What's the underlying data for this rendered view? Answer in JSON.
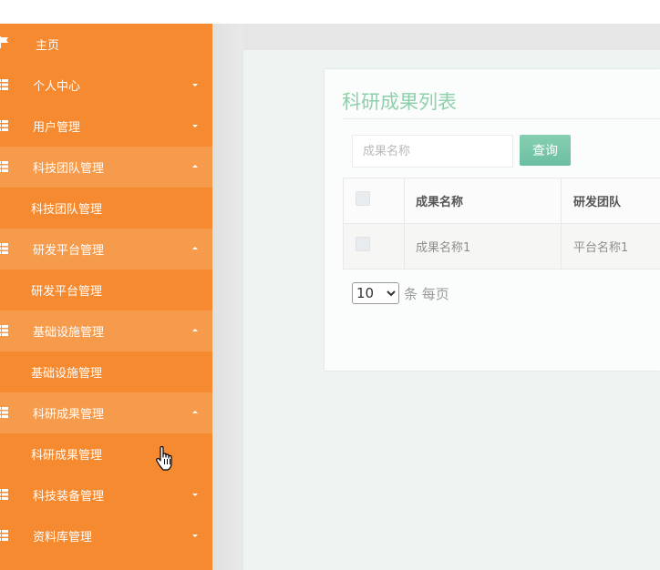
{
  "sidebar": {
    "items": [
      {
        "label": "主页",
        "icon": "flag-icon",
        "caret": "none",
        "open": false
      },
      {
        "label": "个人中心",
        "icon": "grid-icon",
        "caret": "down",
        "open": false
      },
      {
        "label": "用户管理",
        "icon": "grid-icon",
        "caret": "down",
        "open": false
      },
      {
        "label": "科技团队管理",
        "icon": "grid-icon",
        "caret": "up",
        "open": true,
        "sub": "科技团队管理"
      },
      {
        "label": "研发平台管理",
        "icon": "grid-icon",
        "caret": "up",
        "open": true,
        "sub": "研发平台管理"
      },
      {
        "label": "基础设施管理",
        "icon": "grid-icon",
        "caret": "up",
        "open": true,
        "sub": "基础设施管理"
      },
      {
        "label": "科研成果管理",
        "icon": "grid-icon",
        "caret": "up",
        "open": true,
        "sub": "科研成果管理"
      },
      {
        "label": "科技装备管理",
        "icon": "grid-icon",
        "caret": "down",
        "open": false
      },
      {
        "label": "资料库管理",
        "icon": "grid-icon",
        "caret": "down",
        "open": false
      }
    ],
    "color": "#f68a30",
    "open_color": "#f69a4b"
  },
  "main": {
    "title": "科研成果列表",
    "search": {
      "placeholder": "成果名称",
      "value": ""
    },
    "query_label": "查询",
    "table": {
      "columns": [
        "成果名称",
        "研发团队"
      ],
      "rows": [
        [
          "成果名称1",
          "平台名称1"
        ]
      ]
    },
    "pagination": {
      "page_size": "10",
      "per_page_label": "条 每页"
    },
    "accent_color": "#8fd0ab"
  }
}
